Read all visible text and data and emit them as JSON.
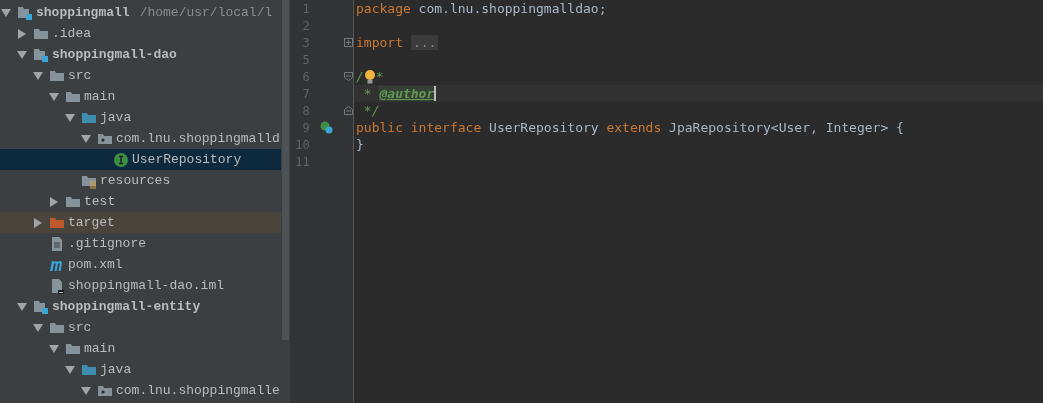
{
  "project_tree": {
    "nodes": [
      {
        "label": "shoppingmall",
        "path": "/home/usr/local/l",
        "kind": "module",
        "expanded": true,
        "selected": false,
        "hovered": false,
        "children": [
          {
            "label": ".idea",
            "kind": "folder",
            "expanded": false,
            "selected": false,
            "hovered": false
          },
          {
            "label": "shoppingmall-dao",
            "kind": "module",
            "expanded": true,
            "selected": false,
            "hovered": false,
            "children": [
              {
                "label": "src",
                "kind": "folder",
                "expanded": true,
                "selected": false,
                "hovered": false,
                "children": [
                  {
                    "label": "main",
                    "kind": "folder",
                    "expanded": true,
                    "selected": false,
                    "hovered": false,
                    "children": [
                      {
                        "label": "java",
                        "kind": "source",
                        "expanded": true,
                        "selected": false,
                        "hovered": false,
                        "children": [
                          {
                            "label": "com.lnu.shoppingmalld",
                            "kind": "package",
                            "expanded": true,
                            "selected": false,
                            "hovered": false,
                            "children": [
                              {
                                "label": "UserRepository",
                                "kind": "interface",
                                "selected": true,
                                "hovered": false
                              }
                            ]
                          }
                        ]
                      },
                      {
                        "label": "resources",
                        "kind": "resources",
                        "selected": false,
                        "hovered": false
                      }
                    ]
                  },
                  {
                    "label": "test",
                    "kind": "folder",
                    "expanded": false,
                    "selected": false,
                    "hovered": false
                  }
                ]
              },
              {
                "label": "target",
                "kind": "excluded",
                "expanded": false,
                "selected": false,
                "hovered": true
              },
              {
                "label": ".gitignore",
                "kind": "text",
                "selected": false,
                "hovered": false
              },
              {
                "label": "pom.xml",
                "kind": "maven",
                "selected": false,
                "hovered": false
              },
              {
                "label": "shoppingmall-dao.iml",
                "kind": "iml",
                "selected": false,
                "hovered": false
              }
            ]
          },
          {
            "label": "shoppingmall-entity",
            "kind": "module",
            "expanded": true,
            "selected": false,
            "hovered": false,
            "children": [
              {
                "label": "src",
                "kind": "folder",
                "expanded": true,
                "selected": false,
                "hovered": false,
                "children": [
                  {
                    "label": "main",
                    "kind": "folder",
                    "expanded": true,
                    "selected": false,
                    "hovered": false,
                    "children": [
                      {
                        "label": "java",
                        "kind": "source",
                        "expanded": true,
                        "selected": false,
                        "hovered": false,
                        "children": [
                          {
                            "label": "com.lnu.shoppingmalle",
                            "kind": "package",
                            "expanded": true,
                            "selected": false,
                            "hovered": false
                          }
                        ]
                      }
                    ]
                  }
                ]
              }
            ]
          }
        ]
      }
    ]
  },
  "editor": {
    "lines": [
      {
        "number": "1",
        "current": false,
        "tokens": [
          {
            "kind": "keyword",
            "text": "package"
          },
          {
            "kind": "plain",
            "text": " com.lnu.shoppingmalldao;"
          }
        ]
      },
      {
        "number": "2",
        "current": false
      },
      {
        "number": "3",
        "current": false,
        "fold": {
          "kind": "expand"
        },
        "tokens": [
          {
            "kind": "keyword",
            "text": "import"
          },
          {
            "kind": "folded",
            "text": "..."
          }
        ]
      },
      {
        "number": "5",
        "current": false
      },
      {
        "number": "6",
        "current": false,
        "fold": {
          "kind": "collapse-start"
        },
        "bulb": true,
        "tokens": [
          {
            "kind": "comment",
            "text": "/"
          },
          {
            "kind": "comment",
            "text": "*"
          }
        ]
      },
      {
        "number": "7",
        "current": true,
        "tokens": [
          {
            "kind": "comment",
            "text": " * "
          },
          {
            "kind": "tag",
            "text": "@author"
          }
        ]
      },
      {
        "number": "8",
        "current": false,
        "fold": {
          "kind": "collapse-end"
        },
        "tokens": [
          {
            "kind": "comment",
            "text": " */"
          }
        ]
      },
      {
        "number": "9",
        "current": false,
        "marker": {
          "kind": "implemented"
        },
        "tokens": [
          {
            "kind": "keyword",
            "text": "public interface"
          },
          {
            "kind": "plain",
            "text": " UserRepository "
          },
          {
            "kind": "keyword",
            "text": "extends"
          },
          {
            "kind": "plain",
            "text": " JpaRepository<User, Integer> {"
          }
        ]
      },
      {
        "number": "10",
        "current": false,
        "tokens": [
          {
            "kind": "plain",
            "text": "}"
          }
        ]
      },
      {
        "number": "11",
        "current": false
      }
    ]
  }
}
